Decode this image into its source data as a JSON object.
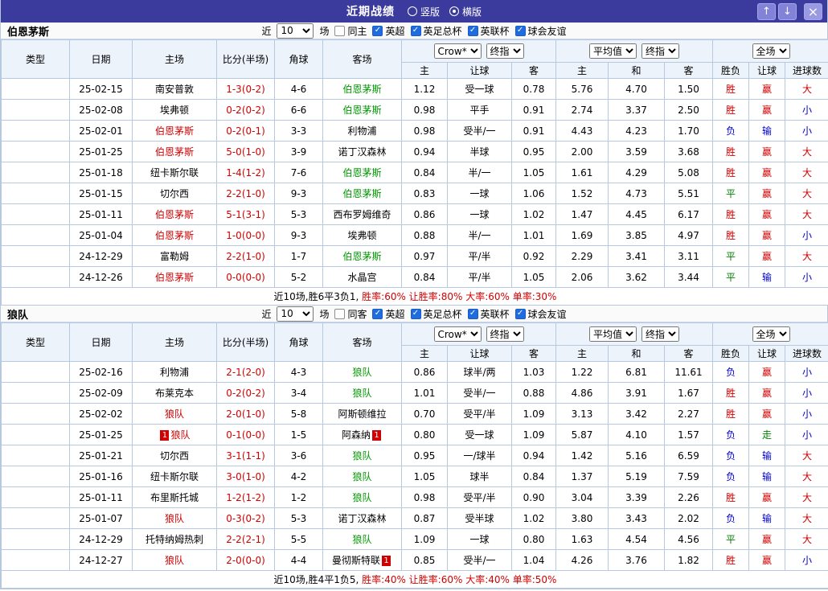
{
  "topbar": {
    "title": "近期战绩",
    "radios": [
      {
        "label": "竖版",
        "selected": false
      },
      {
        "label": "横版",
        "selected": true
      }
    ],
    "up_glyph": "↑",
    "down_glyph": "↓",
    "close_glyph": "×"
  },
  "filter": {
    "near_label": "近",
    "count_value": "10",
    "count_options": [
      "10"
    ],
    "games_label": "场"
  },
  "columns": {
    "type": "类型",
    "date": "日期",
    "home": "主场",
    "score": "比分(半场)",
    "corners": "角球",
    "away": "客场",
    "odds_group_1": [
      "Crow*",
      "终指"
    ],
    "odds_group_2": [
      "平均值",
      "终指"
    ],
    "odds_group_3": [
      "全场"
    ],
    "sub": [
      "主",
      "让球",
      "客",
      "主",
      "和",
      "客",
      "胜负",
      "让球",
      "进球数"
    ]
  },
  "league_colors": {
    "英超": "red",
    "英足总杯": "blue"
  },
  "result_colors": {
    "胜": "red",
    "平": "green",
    "负": "blue",
    "赢": "red",
    "输": "blue",
    "走": "green",
    "大": "red",
    "小": "blue"
  },
  "sections": [
    {
      "team": "伯恩茅斯",
      "same_label": "同主",
      "same_checked": false,
      "leagues": [
        {
          "label": "英超",
          "checked": true
        },
        {
          "label": "英足总杯",
          "checked": true
        },
        {
          "label": "英联杯",
          "checked": true
        },
        {
          "label": "球会友谊",
          "checked": true
        }
      ],
      "rows": [
        {
          "league": "英超",
          "date": "25-02-15",
          "home": {
            "name": "南安普敦"
          },
          "score": "1-3(0-2)",
          "corners": "4-6",
          "away": {
            "name": "伯恩茅斯",
            "hl": true
          },
          "odds": [
            "1.12",
            "受一球",
            "0.78",
            "5.76",
            "4.70",
            "1.50"
          ],
          "results": [
            "胜",
            "赢",
            "大"
          ]
        },
        {
          "league": "英足总杯",
          "date": "25-02-08",
          "home": {
            "name": "埃弗顿"
          },
          "score": "0-2(0-2)",
          "corners": "6-6",
          "away": {
            "name": "伯恩茅斯",
            "hl": true
          },
          "odds": [
            "0.98",
            "平手",
            "0.91",
            "2.74",
            "3.37",
            "2.50"
          ],
          "results": [
            "胜",
            "赢",
            "小"
          ]
        },
        {
          "league": "英超",
          "date": "25-02-01",
          "home": {
            "name": "伯恩茅斯",
            "hl": true
          },
          "score": "0-2(0-1)",
          "corners": "3-3",
          "away": {
            "name": "利物浦"
          },
          "odds": [
            "0.98",
            "受半/一",
            "0.91",
            "4.43",
            "4.23",
            "1.70"
          ],
          "results": [
            "负",
            "输",
            "小"
          ]
        },
        {
          "league": "英超",
          "date": "25-01-25",
          "home": {
            "name": "伯恩茅斯",
            "hl": true
          },
          "score": "5-0(1-0)",
          "corners": "3-9",
          "away": {
            "name": "诺丁汉森林"
          },
          "odds": [
            "0.94",
            "半球",
            "0.95",
            "2.00",
            "3.59",
            "3.68"
          ],
          "results": [
            "胜",
            "赢",
            "大"
          ]
        },
        {
          "league": "英超",
          "date": "25-01-18",
          "home": {
            "name": "纽卡斯尔联"
          },
          "score": "1-4(1-2)",
          "corners": "7-6",
          "away": {
            "name": "伯恩茅斯",
            "hl": true
          },
          "odds": [
            "0.84",
            "半/一",
            "1.05",
            "1.61",
            "4.29",
            "5.08"
          ],
          "results": [
            "胜",
            "赢",
            "大"
          ]
        },
        {
          "league": "英超",
          "date": "25-01-15",
          "home": {
            "name": "切尔西"
          },
          "score": "2-2(1-0)",
          "corners": "9-3",
          "away": {
            "name": "伯恩茅斯",
            "hl": true
          },
          "odds": [
            "0.83",
            "一球",
            "1.06",
            "1.52",
            "4.73",
            "5.51"
          ],
          "results": [
            "平",
            "赢",
            "大"
          ]
        },
        {
          "league": "英足总杯",
          "date": "25-01-11",
          "home": {
            "name": "伯恩茅斯",
            "hl": true
          },
          "score": "5-1(3-1)",
          "corners": "5-3",
          "away": {
            "name": "西布罗姆维奇"
          },
          "odds": [
            "0.86",
            "一球",
            "1.02",
            "1.47",
            "4.45",
            "6.17"
          ],
          "results": [
            "胜",
            "赢",
            "大"
          ]
        },
        {
          "league": "英超",
          "date": "25-01-04",
          "home": {
            "name": "伯恩茅斯",
            "hl": true
          },
          "score": "1-0(0-0)",
          "corners": "9-3",
          "away": {
            "name": "埃弗顿"
          },
          "odds": [
            "0.88",
            "半/一",
            "1.01",
            "1.69",
            "3.85",
            "4.97"
          ],
          "results": [
            "胜",
            "赢",
            "小"
          ]
        },
        {
          "league": "英超",
          "date": "24-12-29",
          "home": {
            "name": "富勒姆"
          },
          "score": "2-2(1-0)",
          "corners": "1-7",
          "away": {
            "name": "伯恩茅斯",
            "hl": true
          },
          "odds": [
            "0.97",
            "平/半",
            "0.92",
            "2.29",
            "3.41",
            "3.11"
          ],
          "results": [
            "平",
            "赢",
            "大"
          ]
        },
        {
          "league": "英超",
          "date": "24-12-26",
          "home": {
            "name": "伯恩茅斯",
            "hl": true
          },
          "score": "0-0(0-0)",
          "corners": "5-2",
          "away": {
            "name": "水晶宫"
          },
          "odds": [
            "0.84",
            "平/半",
            "1.05",
            "2.06",
            "3.62",
            "3.44"
          ],
          "results": [
            "平",
            "输",
            "小"
          ]
        }
      ],
      "summary_prefix": "近10场,胜6平3负1,",
      "summary_stats": "胜率:60% 让胜率:80% 大率:60% 单率:30%"
    },
    {
      "team": "狼队",
      "same_label": "同客",
      "same_checked": false,
      "leagues": [
        {
          "label": "英超",
          "checked": true
        },
        {
          "label": "英足总杯",
          "checked": true
        },
        {
          "label": "英联杯",
          "checked": true
        },
        {
          "label": "球会友谊",
          "checked": true
        }
      ],
      "rows": [
        {
          "league": "英超",
          "date": "25-02-16",
          "home": {
            "name": "利物浦"
          },
          "score": "2-1(2-0)",
          "corners": "4-3",
          "away": {
            "name": "狼队",
            "hl": true
          },
          "odds": [
            "0.86",
            "球半/两",
            "1.03",
            "1.22",
            "6.81",
            "11.61"
          ],
          "results": [
            "负",
            "赢",
            "小"
          ]
        },
        {
          "league": "英足总杯",
          "date": "25-02-09",
          "home": {
            "name": "布莱克本"
          },
          "score": "0-2(0-2)",
          "corners": "3-4",
          "away": {
            "name": "狼队",
            "hl": true
          },
          "odds": [
            "1.01",
            "受半/一",
            "0.88",
            "4.86",
            "3.91",
            "1.67"
          ],
          "results": [
            "胜",
            "赢",
            "小"
          ]
        },
        {
          "league": "英超",
          "date": "25-02-02",
          "home": {
            "name": "狼队",
            "hl": true
          },
          "score": "2-0(1-0)",
          "corners": "5-8",
          "away": {
            "name": "阿斯顿维拉"
          },
          "odds": [
            "0.70",
            "受平/半",
            "1.09",
            "3.13",
            "3.42",
            "2.27"
          ],
          "results": [
            "胜",
            "赢",
            "小"
          ]
        },
        {
          "league": "英超",
          "date": "25-01-25",
          "home": {
            "name": "狼队",
            "hl": true,
            "card": "1"
          },
          "score": "0-1(0-0)",
          "corners": "1-5",
          "away": {
            "name": "阿森纳",
            "card": "1"
          },
          "odds": [
            "0.80",
            "受一球",
            "1.09",
            "5.87",
            "4.10",
            "1.57"
          ],
          "results": [
            "负",
            "走",
            "小"
          ]
        },
        {
          "league": "英超",
          "date": "25-01-21",
          "home": {
            "name": "切尔西"
          },
          "score": "3-1(1-1)",
          "corners": "3-6",
          "away": {
            "name": "狼队",
            "hl": true
          },
          "odds": [
            "0.95",
            "一/球半",
            "0.94",
            "1.42",
            "5.16",
            "6.59"
          ],
          "results": [
            "负",
            "输",
            "大"
          ]
        },
        {
          "league": "英超",
          "date": "25-01-16",
          "home": {
            "name": "纽卡斯尔联"
          },
          "score": "3-0(1-0)",
          "corners": "4-2",
          "away": {
            "name": "狼队",
            "hl": true
          },
          "odds": [
            "1.05",
            "球半",
            "0.84",
            "1.37",
            "5.19",
            "7.59"
          ],
          "results": [
            "负",
            "输",
            "大"
          ]
        },
        {
          "league": "英足总杯",
          "date": "25-01-11",
          "home": {
            "name": "布里斯托城"
          },
          "score": "1-2(1-2)",
          "corners": "1-2",
          "away": {
            "name": "狼队",
            "hl": true
          },
          "odds": [
            "0.98",
            "受平/半",
            "0.90",
            "3.04",
            "3.39",
            "2.26"
          ],
          "results": [
            "胜",
            "赢",
            "大"
          ]
        },
        {
          "league": "英超",
          "date": "25-01-07",
          "home": {
            "name": "狼队",
            "hl": true
          },
          "score": "0-3(0-2)",
          "corners": "5-3",
          "away": {
            "name": "诺丁汉森林"
          },
          "odds": [
            "0.87",
            "受半球",
            "1.02",
            "3.80",
            "3.43",
            "2.02"
          ],
          "results": [
            "负",
            "输",
            "大"
          ]
        },
        {
          "league": "英超",
          "date": "24-12-29",
          "home": {
            "name": "托特纳姆热刺"
          },
          "score": "2-2(2-1)",
          "corners": "5-5",
          "away": {
            "name": "狼队",
            "hl": true
          },
          "odds": [
            "1.09",
            "一球",
            "0.80",
            "1.63",
            "4.54",
            "4.56"
          ],
          "results": [
            "平",
            "赢",
            "大"
          ]
        },
        {
          "league": "英超",
          "date": "24-12-27",
          "home": {
            "name": "狼队",
            "hl": true
          },
          "score": "2-0(0-0)",
          "corners": "4-4",
          "away": {
            "name": "曼彻斯特联",
            "card": "1"
          },
          "odds": [
            "0.85",
            "受半/一",
            "1.04",
            "4.26",
            "3.76",
            "1.82"
          ],
          "results": [
            "胜",
            "赢",
            "小"
          ]
        }
      ],
      "summary_prefix": "近10场,胜4平1负5,",
      "summary_stats": "胜率:40% 让胜率:60% 大率:40% 单率:50%"
    }
  ]
}
